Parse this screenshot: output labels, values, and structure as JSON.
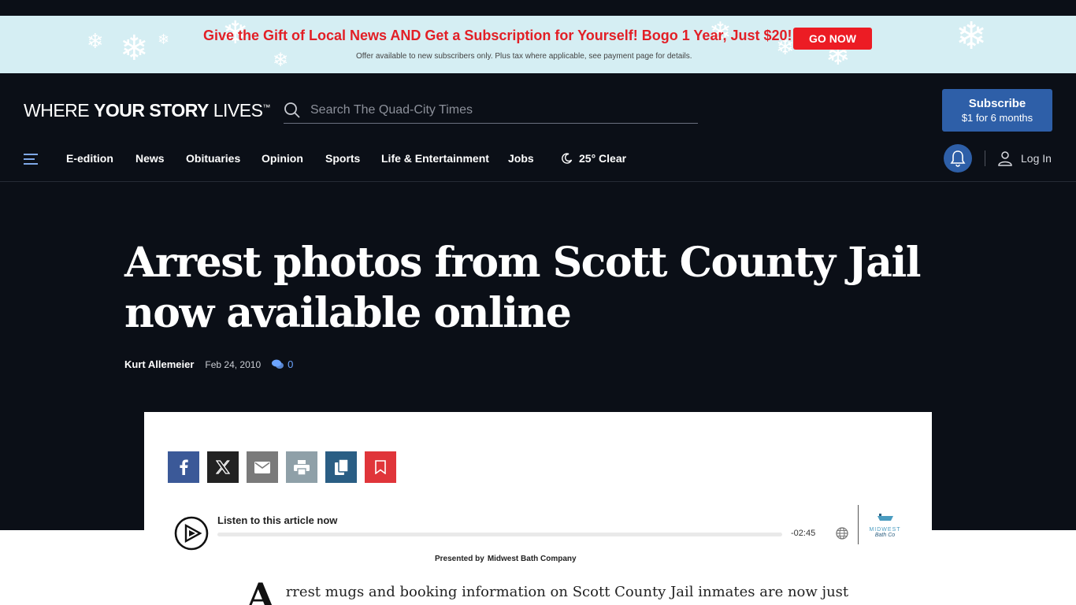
{
  "promo": {
    "headline": "Give the Gift of Local News AND Get a Subscription for Yourself! Bogo 1 Year, Just $20!",
    "subtext": "Offer available to new subscribers only. Plus tax where applicable, see payment page for details.",
    "button_label": "GO NOW",
    "colors": {
      "background": "#d5eef3",
      "headline": "#e21f26",
      "button": "#ec1c24"
    }
  },
  "header": {
    "logo": {
      "part1": "WHERE ",
      "part2": "YOUR STORY",
      "part3": " LIVES",
      "tm": "™"
    },
    "search": {
      "placeholder": "Search The Quad-City Times",
      "icon": "search-icon"
    },
    "subscribe": {
      "line1": "Subscribe",
      "line2": "$1 for 6 months"
    }
  },
  "nav": {
    "menu_icon": "hamburger-icon",
    "items": [
      {
        "label": "E-edition"
      },
      {
        "label": "News"
      },
      {
        "label": "Obituaries"
      },
      {
        "label": "Opinion"
      },
      {
        "label": "Sports"
      },
      {
        "label": "Life & Entertainment"
      },
      {
        "label": "Jobs"
      }
    ],
    "weather": {
      "icon": "moon-icon",
      "label": "25° Clear"
    },
    "notifications_icon": "bell-icon",
    "login": {
      "icon": "user-icon",
      "label": "Log In"
    }
  },
  "article": {
    "headline": "Arrest photos from Scott County Jail now available online",
    "author": "Kurt Allemeier",
    "date": "Feb 24, 2010",
    "comment_count": "0",
    "share_buttons": [
      "facebook-icon",
      "x-icon",
      "email-icon",
      "print-icon",
      "copy-icon",
      "bookmark-icon"
    ],
    "audio": {
      "label": "Listen to this article now",
      "time_remaining": "-02:45",
      "presented_by_label": "Presented by",
      "sponsor": "Midwest Bath Company",
      "sponsor_logo_name": "MIDWEST",
      "sponsor_logo_script": "Bath Co"
    },
    "dropcap": "A",
    "first_line": "rrest mugs and booking information on Scott County Jail inmates are now just"
  }
}
